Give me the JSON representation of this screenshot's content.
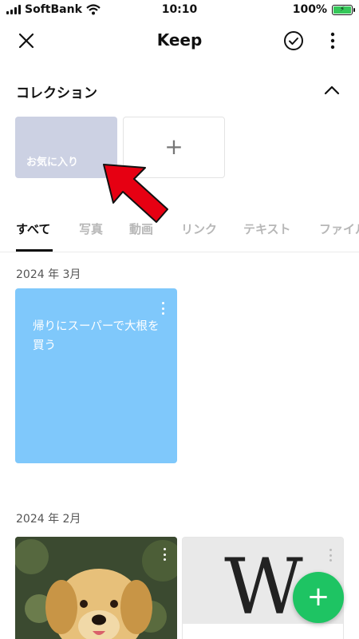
{
  "status_bar": {
    "carrier": "SoftBank",
    "time": "10:10",
    "battery": "100%"
  },
  "header": {
    "title": "Keep"
  },
  "collection": {
    "title": "コレクション",
    "favorite_label": "お気に入り",
    "add_label": "+"
  },
  "tabs": [
    "すべて",
    "写真",
    "動画",
    "リンク",
    "テキスト",
    "ファイル"
  ],
  "sections": [
    {
      "date": "2024 年 3月",
      "note_text": "帰りにスーパーで大根を買う"
    },
    {
      "date": "2024 年 2月"
    }
  ],
  "wiki_letter": "W",
  "fab_label": "+",
  "colors": {
    "accent": "#1ec463",
    "favorite_card": "#ccd1e3",
    "note_card": "#7fc8fb",
    "annotation_arrow": "#e60012"
  }
}
